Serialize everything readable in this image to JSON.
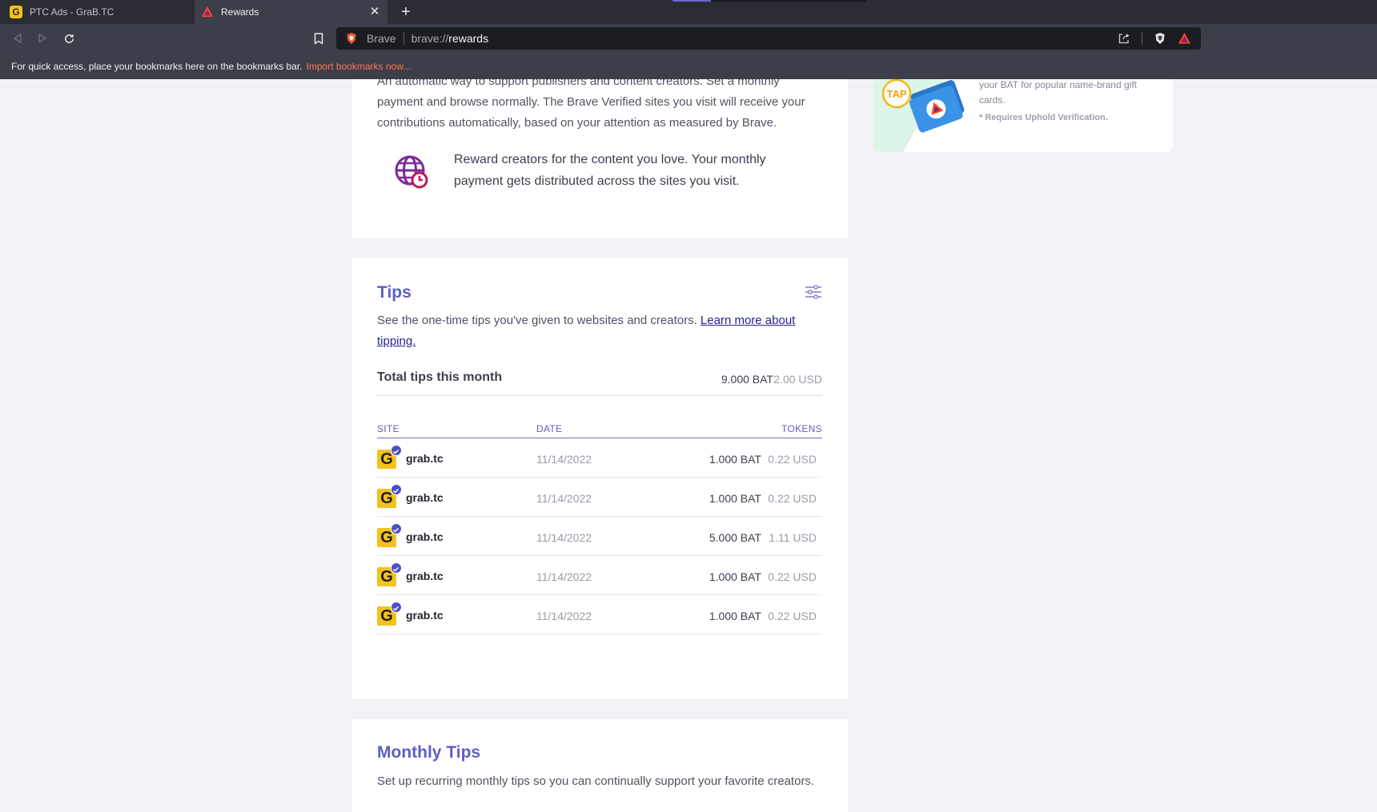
{
  "browser": {
    "tabs": [
      {
        "title": "PTC Ads - GraB.TC",
        "favicon": "grab-g-icon"
      },
      {
        "title": "Rewards",
        "favicon": "bat-triangle-icon"
      }
    ],
    "omnibox": {
      "label": "Brave",
      "scheme": "brave://",
      "path": "rewards"
    },
    "bookmarks_bar": {
      "message": "For quick access, place your bookmarks here on the bookmarks bar.",
      "import_link": "Import bookmarks now..."
    }
  },
  "auto_contribute": {
    "description": "An automatic way to support publishers and content creators. Set a monthly payment and browse normally. The Brave Verified sites you visit will receive your contributions automatically, based on your attention as measured by Brave.",
    "reward_text": "Reward creators for the content you love. Your monthly payment gets distributed across the sites you visit."
  },
  "promo": {
    "text": "your BAT for popular name-brand gift cards.",
    "note": "* Requires Uphold Verification.",
    "badge": "TAP"
  },
  "tips": {
    "title": "Tips",
    "description": "See the one-time tips you've given to websites and creators.",
    "learn_more": "Learn more about tipping.",
    "total_label": "Total tips this month",
    "total_bat": "9.000 BAT",
    "total_usd": "2.00 USD",
    "columns": {
      "site": "SITE",
      "date": "DATE",
      "tokens": "TOKENS"
    },
    "rows": [
      {
        "site": "grab.tc",
        "date": "11/14/2022",
        "bat": "1.000 BAT",
        "usd": "0.22 USD",
        "icon_letter": "G"
      },
      {
        "site": "grab.tc",
        "date": "11/14/2022",
        "bat": "1.000 BAT",
        "usd": "0.22 USD",
        "icon_letter": "G"
      },
      {
        "site": "grab.tc",
        "date": "11/14/2022",
        "bat": "5.000 BAT",
        "usd": "1.11 USD",
        "icon_letter": "G"
      },
      {
        "site": "grab.tc",
        "date": "11/14/2022",
        "bat": "1.000 BAT",
        "usd": "0.22 USD",
        "icon_letter": "G"
      },
      {
        "site": "grab.tc",
        "date": "11/14/2022",
        "bat": "1.000 BAT",
        "usd": "0.22 USD",
        "icon_letter": "G"
      }
    ]
  },
  "monthly_tips": {
    "title": "Monthly Tips",
    "description": "Set up recurring monthly tips so you can continually support your favorite creators."
  },
  "colors": {
    "accent": "#5e5fc3",
    "link": "#21258f",
    "import_link": "#ff7654",
    "grab_yellow": "#f4c21b"
  }
}
